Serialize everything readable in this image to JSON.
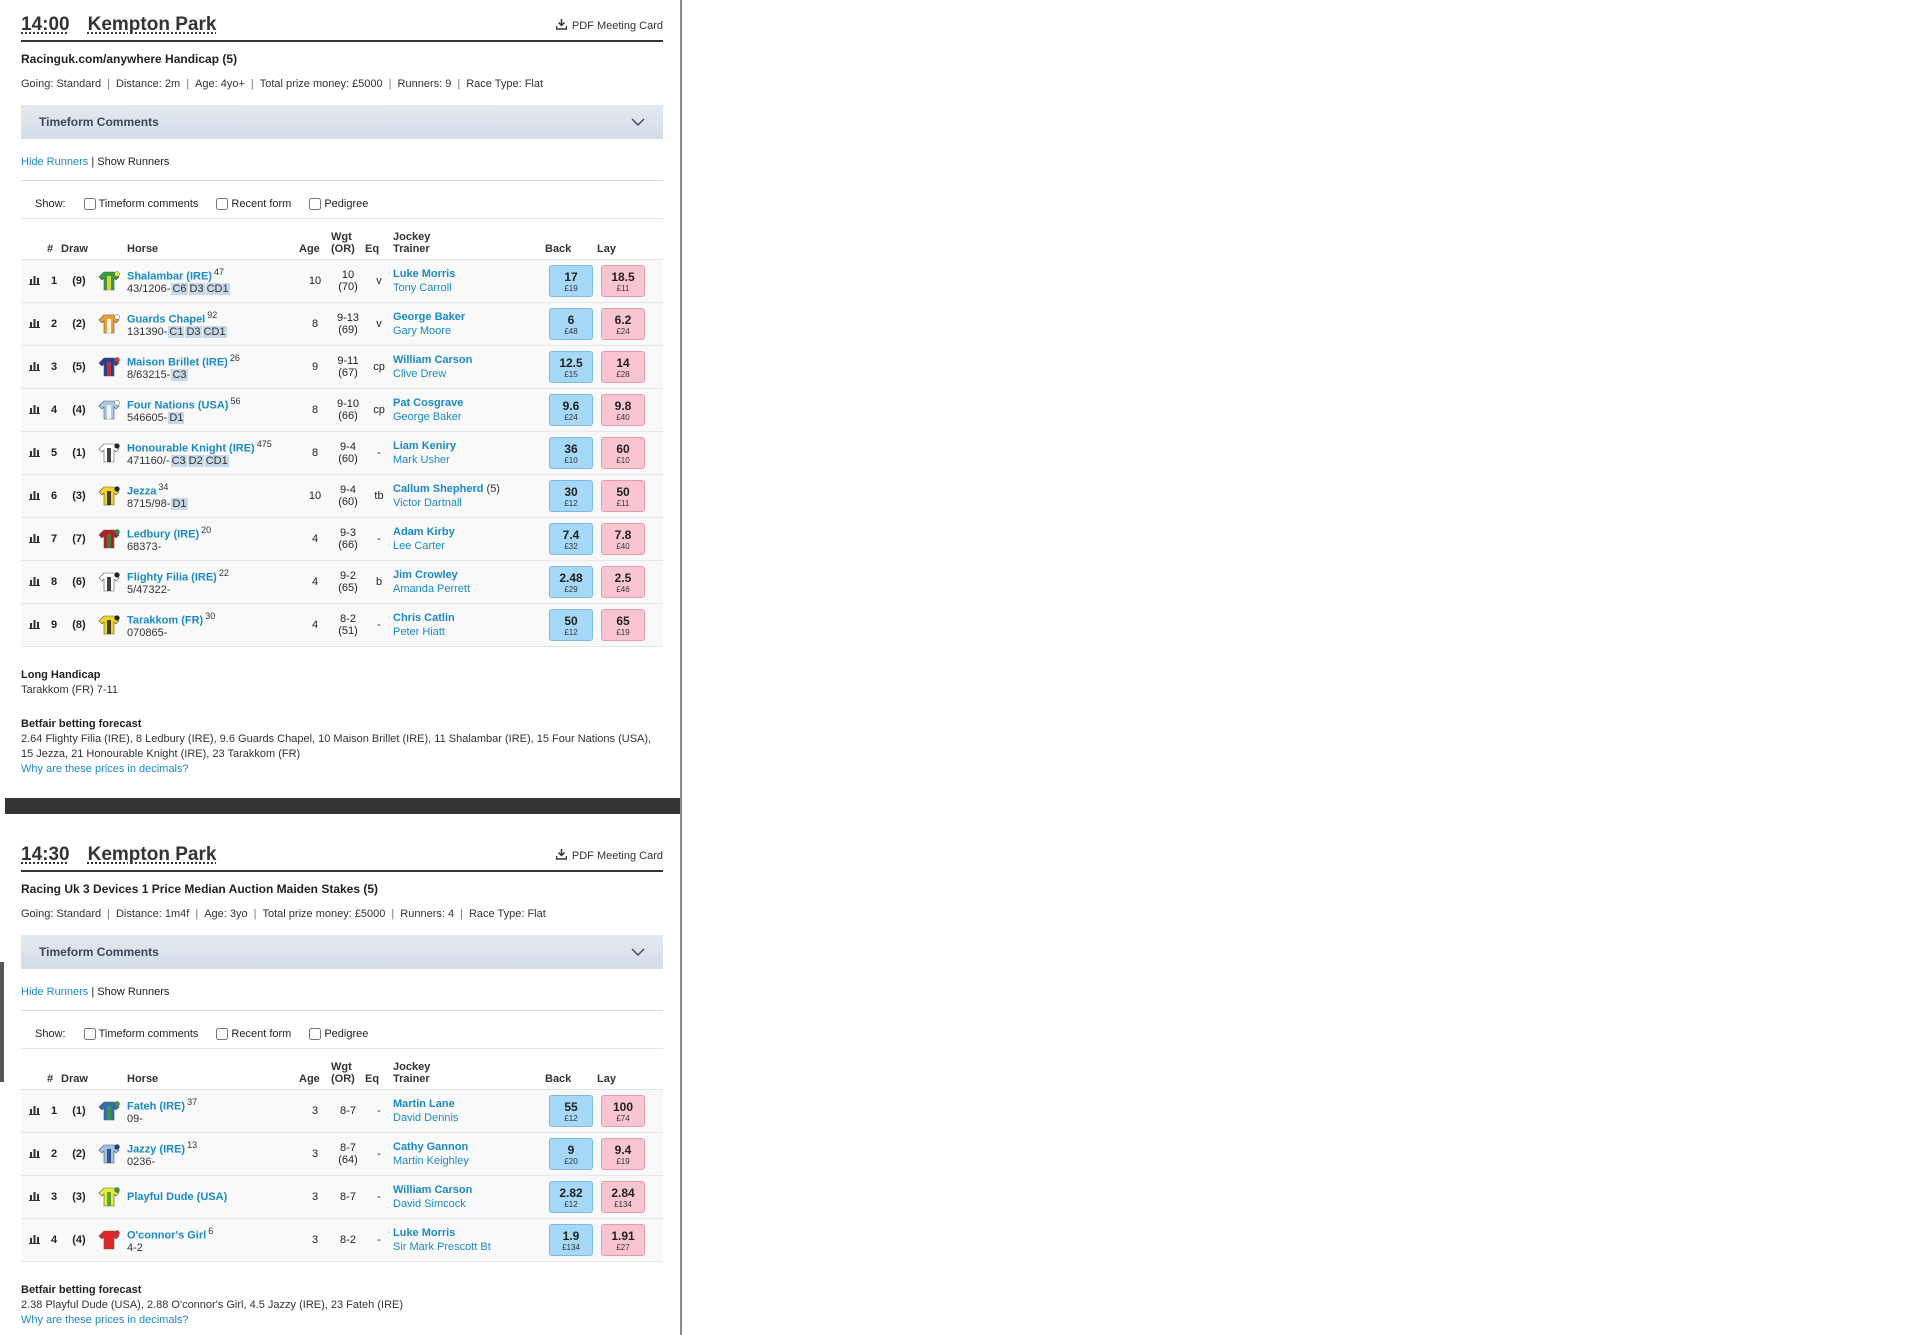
{
  "pdf_label": "PDF Meeting Card",
  "timeform_label": "Timeform Comments",
  "hide_runners": "Hide Runners",
  "show_runners": "Show Runners",
  "show_label": "Show:",
  "opt_comments": "Timeform comments",
  "opt_form": "Recent form",
  "opt_pedigree": "Pedigree",
  "headers": {
    "num": "#",
    "draw": "Draw",
    "horse": "Horse",
    "age": "Age",
    "wgt": "Wgt",
    "or": "(OR)",
    "eq": "Eq",
    "jockey": "Jockey",
    "trainer": "Trainer",
    "back": "Back",
    "lay": "Lay"
  },
  "why_link": "Why are these prices in decimals?",
  "races": [
    {
      "time": "14:00",
      "course": "Kempton Park",
      "name": "Racinguk.com/anywhere Handicap (5)",
      "info": [
        "Going: Standard",
        "Distance: 2m",
        "Age: 4yo+",
        "Total prize money: £5000",
        "Runners: 9",
        "Race Type: Flat"
      ],
      "runners": [
        {
          "num": "1",
          "draw": "(9)",
          "horse": "Shalambar (IRE)",
          "rating": "47",
          "form": "43/1206-",
          "badges": [
            "C6",
            "D3",
            "CD1"
          ],
          "age": "10",
          "wgt": "10",
          "or": "(70)",
          "eq": "v",
          "jockey": "Luke Morris",
          "claim": "",
          "trainer": "Tony Carroll",
          "back": "17",
          "back_amt": "£19",
          "lay": "18.5",
          "lay_amt": "£11",
          "silk": [
            "#3a9c3a",
            "#f4e23a"
          ]
        },
        {
          "num": "2",
          "draw": "(2)",
          "horse": "Guards Chapel",
          "rating": "92",
          "form": "131390-",
          "badges": [
            "C1",
            "D3",
            "CD1"
          ],
          "age": "8",
          "wgt": "9-13",
          "or": "(69)",
          "eq": "v",
          "jockey": "George Baker",
          "claim": "",
          "trainer": "Gary Moore",
          "back": "6",
          "back_amt": "£48",
          "lay": "6.2",
          "lay_amt": "£24",
          "silk": [
            "#f0a030",
            "#ffffff"
          ]
        },
        {
          "num": "3",
          "draw": "(5)",
          "horse": "Maison Brillet (IRE)",
          "rating": "26",
          "form": "8/63215-",
          "badges": [
            "C3"
          ],
          "age": "9",
          "wgt": "9-11",
          "or": "(67)",
          "eq": "cp",
          "jockey": "William Carson",
          "claim": "",
          "trainer": "Clive Drew",
          "back": "12.5",
          "back_amt": "£15",
          "lay": "14",
          "lay_amt": "£28",
          "silk": [
            "#2a3d8f",
            "#d83030"
          ]
        },
        {
          "num": "4",
          "draw": "(4)",
          "horse": "Four Nations (USA)",
          "rating": "56",
          "form": "546605-",
          "badges": [
            "D1"
          ],
          "age": "8",
          "wgt": "9-10",
          "or": "(66)",
          "eq": "cp",
          "jockey": "Pat Cosgrave",
          "claim": "",
          "trainer": "George Baker",
          "back": "9.6",
          "back_amt": "£24",
          "lay": "9.8",
          "lay_amt": "£40",
          "silk": [
            "#a9c8ea",
            "#ffffff"
          ]
        },
        {
          "num": "5",
          "draw": "(1)",
          "horse": "Honourable Knight (IRE)",
          "rating": "475",
          "form": "471160/-",
          "badges": [
            "C3",
            "D2",
            "CD1"
          ],
          "age": "8",
          "wgt": "9-4",
          "or": "(60)",
          "eq": "-",
          "jockey": "Liam Keniry",
          "claim": "",
          "trainer": "Mark Usher",
          "back": "36",
          "back_amt": "£10",
          "lay": "60",
          "lay_amt": "£10",
          "silk": [
            "#ffffff",
            "#222222"
          ]
        },
        {
          "num": "6",
          "draw": "(3)",
          "horse": "Jezza",
          "rating": "34",
          "form": "8715/98-",
          "badges": [
            "D1"
          ],
          "age": "10",
          "wgt": "9-4",
          "or": "(60)",
          "eq": "tb",
          "jockey": "Callum Shepherd",
          "claim": "(5)",
          "trainer": "Victor Dartnall",
          "back": "30",
          "back_amt": "£12",
          "lay": "50",
          "lay_amt": "£11",
          "silk": [
            "#f2d61a",
            "#222222"
          ]
        },
        {
          "num": "7",
          "draw": "(7)",
          "horse": "Ledbury (IRE)",
          "rating": "20",
          "form": "68373-",
          "badges": [],
          "age": "4",
          "wgt": "9-3",
          "or": "(66)",
          "eq": "-",
          "jockey": "Adam Kirby",
          "claim": "",
          "trainer": "Lee Carter",
          "back": "7.4",
          "back_amt": "£32",
          "lay": "7.8",
          "lay_amt": "£40",
          "silk": [
            "#b02020",
            "#2e8b3e"
          ]
        },
        {
          "num": "8",
          "draw": "(6)",
          "horse": "Flighty Filia (IRE)",
          "rating": "22",
          "form": "5/47322-",
          "badges": [],
          "age": "4",
          "wgt": "9-2",
          "or": "(65)",
          "eq": "b",
          "jockey": "Jim Crowley",
          "claim": "",
          "trainer": "Amanda Perrett",
          "back": "2.48",
          "back_amt": "£29",
          "lay": "2.5",
          "lay_amt": "£46",
          "silk": [
            "#ffffff",
            "#222222"
          ]
        },
        {
          "num": "9",
          "draw": "(8)",
          "horse": "Tarakkom (FR)",
          "rating": "30",
          "form": "070865-",
          "badges": [],
          "age": "4",
          "wgt": "8-2",
          "or": "(51)",
          "eq": "-",
          "jockey": "Chris Catlin",
          "claim": "",
          "trainer": "Peter Hiatt",
          "back": "50",
          "back_amt": "£12",
          "lay": "65",
          "lay_amt": "£19",
          "silk": [
            "#f2d61a",
            "#222222"
          ]
        }
      ],
      "long_handicap_title": "Long Handicap",
      "long_handicap_text": "Tarakkom (FR) 7-11",
      "forecast_title": "Betfair betting forecast",
      "forecast_text": "2.64 Flighty Filia (IRE), 8 Ledbury (IRE), 9.6 Guards Chapel, 10 Maison Brillet (IRE), 11 Shalambar (IRE), 15 Four Nations (USA), 15 Jezza, 21 Honourable Knight (IRE), 23 Tarakkom (FR)"
    },
    {
      "time": "14:30",
      "course": "Kempton Park",
      "name": "Racing Uk 3 Devices 1 Price Median Auction Maiden Stakes (5)",
      "info": [
        "Going: Standard",
        "Distance: 1m4f",
        "Age: 3yo",
        "Total prize money: £5000",
        "Runners: 4",
        "Race Type: Flat"
      ],
      "runners": [
        {
          "num": "1",
          "draw": "(1)",
          "horse": "Fateh (IRE)",
          "rating": "37",
          "form": "09-",
          "badges": [],
          "age": "3",
          "wgt": "8-7",
          "or": "",
          "eq": "-",
          "jockey": "Martin Lane",
          "claim": "",
          "trainer": "David Dennis",
          "back": "55",
          "back_amt": "£12",
          "lay": "100",
          "lay_amt": "£74",
          "silk": [
            "#2f6fb0",
            "#3a9c3a"
          ]
        },
        {
          "num": "2",
          "draw": "(2)",
          "horse": "Jazzy (IRE)",
          "rating": "13",
          "form": "0236-",
          "badges": [],
          "age": "3",
          "wgt": "8-7",
          "or": "(64)",
          "eq": "-",
          "jockey": "Cathy Gannon",
          "claim": "",
          "trainer": "Martin Keighley",
          "back": "9",
          "back_amt": "£20",
          "lay": "9.4",
          "lay_amt": "£19",
          "silk": [
            "#9ec4ea",
            "#1e3f7a"
          ]
        },
        {
          "num": "3",
          "draw": "(3)",
          "horse": "Playful Dude (USA)",
          "rating": "",
          "form": "",
          "badges": [],
          "age": "3",
          "wgt": "8-7",
          "or": "",
          "eq": "-",
          "jockey": "William Carson",
          "claim": "",
          "trainer": "David Simcock",
          "back": "2.82",
          "back_amt": "£12",
          "lay": "2.84",
          "lay_amt": "£134",
          "silk": [
            "#e9ee3a",
            "#3a9c3a"
          ]
        },
        {
          "num": "4",
          "draw": "(4)",
          "horse": "O'connor's Girl",
          "rating": "6",
          "form": "4-2",
          "badges": [],
          "age": "3",
          "wgt": "8-2",
          "or": "",
          "eq": "-",
          "jockey": "Luke Morris",
          "claim": "",
          "trainer": "Sir Mark Prescott Bt",
          "back": "1.9",
          "back_amt": "£134",
          "lay": "1.91",
          "lay_amt": "£27",
          "silk": [
            "#e02828",
            "#e02828"
          ]
        }
      ],
      "long_handicap_title": "",
      "long_handicap_text": "",
      "forecast_title": "Betfair betting forecast",
      "forecast_text": "2.38 Playful Dude (USA), 2.88 O'connor's Girl, 4.5 Jazzy (IRE), 23 Fateh (IRE)"
    }
  ]
}
